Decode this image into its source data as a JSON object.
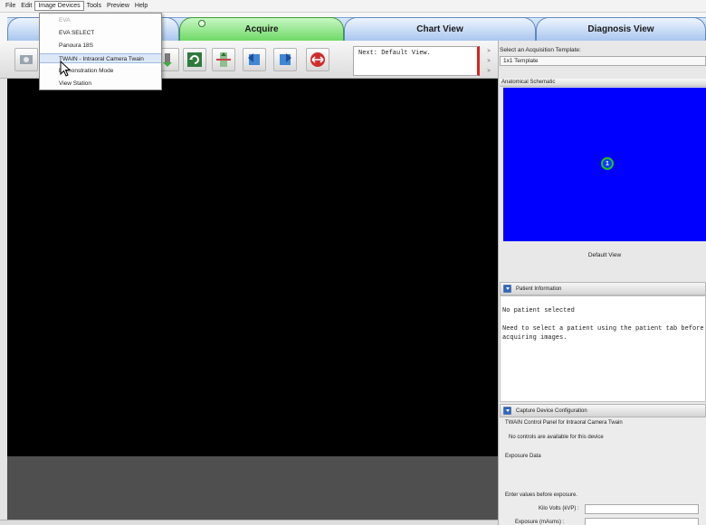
{
  "menubar": {
    "items": [
      "File",
      "Edit",
      "Image Devices",
      "Tools",
      "Preview",
      "Help"
    ],
    "open_item": "Image Devices"
  },
  "dropdown": {
    "items": [
      {
        "label": "EVA",
        "enabled": false
      },
      {
        "label": "EVA SELECT",
        "enabled": true
      },
      {
        "label": "Panoura 18S",
        "enabled": true
      },
      {
        "label": "TWAIN - Intraoral Camera Twain",
        "enabled": true,
        "hovered": true
      },
      {
        "label": "Demonstration Mode",
        "enabled": true
      },
      {
        "label": "View Station",
        "enabled": true
      }
    ]
  },
  "tabs": [
    {
      "label": "",
      "active": false
    },
    {
      "label": "Acquire",
      "active": true
    },
    {
      "label": "Chart View",
      "active": false
    },
    {
      "label": "Diagnosis View",
      "active": false
    }
  ],
  "toolbar": {
    "icons": [
      "camera-icon",
      "device-icon",
      "rotate-icon",
      "flip-vertical-icon",
      "rotate-left-icon",
      "rotate-right-icon",
      "flip-horizontal-icon"
    ],
    "next_view": "Next: Default View."
  },
  "template": {
    "label": "Select an Acquisition Template:",
    "selected": "1x1 Template"
  },
  "schematic": {
    "title": "Anatomical Schematic",
    "marker": "1",
    "caption": "Default View",
    "bg_color": "#0000ff",
    "marker_ring_color": "#1ec51e"
  },
  "patient_info": {
    "title": "Patient Information",
    "line1": "No patient selected",
    "line2a": "Need to select a patient using the patient tab before",
    "line2b": "acquiring images."
  },
  "capture_config": {
    "title": "Capture Device Configuration",
    "panel_name": "TWAIN Control Panel for Intraoral Camera Twain",
    "no_controls": "No controls are available for this device",
    "exposure_title": "Exposure Data",
    "enter_values": "Enter values before exposure.",
    "kv_label": "Kilo Volts (kVP) :",
    "exposure_label": "Exposure (mAsms) :"
  },
  "colors": {
    "accent_active_tab": "#6ed966",
    "tab_blue": "#a9c6ee",
    "next_border": "#e02020"
  }
}
